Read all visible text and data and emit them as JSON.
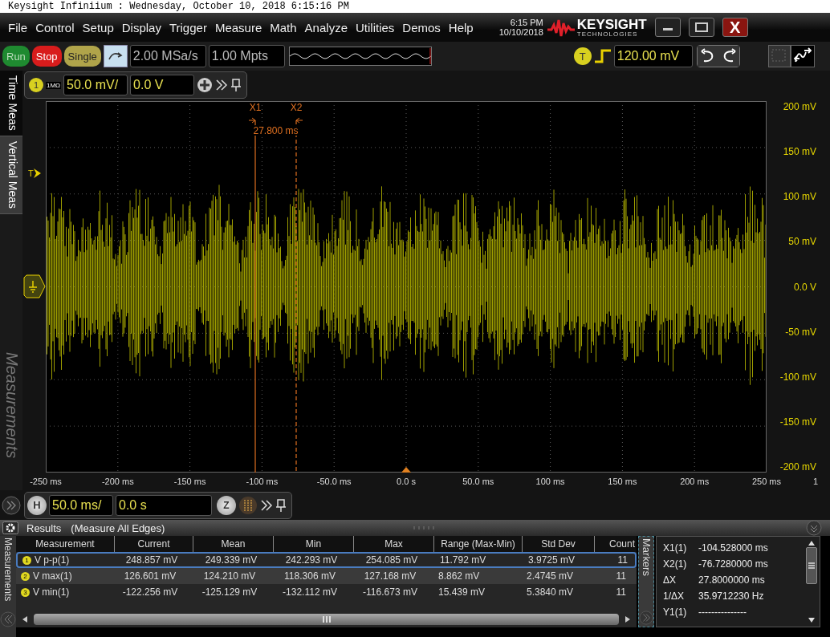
{
  "window": {
    "title": "Keysight Infiniium : Wednesday, October 10, 2018 6:15:16 PM",
    "close_label": "X"
  },
  "menu": [
    "File",
    "Control",
    "Setup",
    "Display",
    "Trigger",
    "Measure",
    "Math",
    "Analyze",
    "Utilities",
    "Demos",
    "Help"
  ],
  "clock": {
    "time": "6:15 PM",
    "date": "10/10/2018"
  },
  "logo": {
    "name": "KEYSIGHT",
    "subtitle": "TECHNOLOGIES"
  },
  "toolbar": {
    "run_buttons": [
      {
        "label": "Run",
        "kind": "run"
      },
      {
        "label": "Stop",
        "kind": "stop"
      },
      {
        "label": "Single",
        "kind": "single"
      }
    ],
    "sample_rate": "2.00 MSa/s",
    "memory_depth": "1.00 Mpts",
    "trigger_badge": "T",
    "trigger_level": "120.00 mV"
  },
  "side_tabs": [
    {
      "label": "Time Meas",
      "selected": false
    },
    {
      "label": "Vertical Meas",
      "selected": true
    }
  ],
  "side_panel_title": "Measurements",
  "channel": {
    "number": "1",
    "impedance": "1MΩ",
    "scale": "50.0 mV/",
    "offset": "0.0 V"
  },
  "graph": {
    "trigger_marker": "T",
    "cursors": [
      {
        "label": "X1",
        "kind": "solid"
      },
      {
        "label": "X2",
        "kind": "dashed"
      }
    ],
    "delta": "27.800 ms",
    "y_labels": [
      "200 mV",
      "150 mV",
      "100 mV",
      "50 mV",
      "0.0 V",
      "-50 mV",
      "-100 mV",
      "-150 mV",
      "-200 mV"
    ],
    "x_labels": [
      "-250 ms",
      "-200 ms",
      "-150 ms",
      "-100 ms",
      "-50.0 ms",
      "0.0 s",
      "50.0 ms",
      "100 ms",
      "150 ms",
      "200 ms",
      "250 ms"
    ],
    "channel_label": "1"
  },
  "timebase": {
    "badge": "H",
    "scale": "50.0 ms/",
    "position": "0.0 s",
    "zoom_badge": "Z"
  },
  "results": {
    "title": "Results",
    "subtitle": "(Measure All Edges)",
    "side_label": "Measurements",
    "columns": [
      "Measurement",
      "Current",
      "Mean",
      "Min",
      "Max",
      "Range (Max-Min)",
      "Std Dev",
      "Count"
    ],
    "rows": [
      {
        "index": "1",
        "cells": [
          "V p-p(1)",
          "248.857 mV",
          "249.339 mV",
          "242.293 mV",
          "254.085 mV",
          "11.792 mV",
          "3.9725 mV",
          "11"
        ],
        "selected": true
      },
      {
        "index": "2",
        "cells": [
          "V max(1)",
          "126.601 mV",
          "124.210 mV",
          "118.306 mV",
          "127.168 mV",
          "8.862 mV",
          "2.4745 mV",
          "11"
        ],
        "selected": false
      },
      {
        "index": "3",
        "cells": [
          "V min(1)",
          "-122.256 mV",
          "-125.129 mV",
          "-132.112 mV",
          "-116.673 mV",
          "15.439 mV",
          "5.3840 mV",
          "11"
        ],
        "selected": false
      }
    ]
  },
  "markers": {
    "side_label": "Markers",
    "rows": [
      {
        "label": "X1(1)",
        "value": "-104.528000 ms"
      },
      {
        "label": "X2(1)",
        "value": "-76.7280000 ms"
      },
      {
        "label": "ΔX",
        "value": "27.8000000 ms"
      },
      {
        "label": "1/ΔX",
        "value": "35.9712230 Hz"
      },
      {
        "label": "Y1(1)",
        "value": "---------------"
      }
    ]
  }
}
